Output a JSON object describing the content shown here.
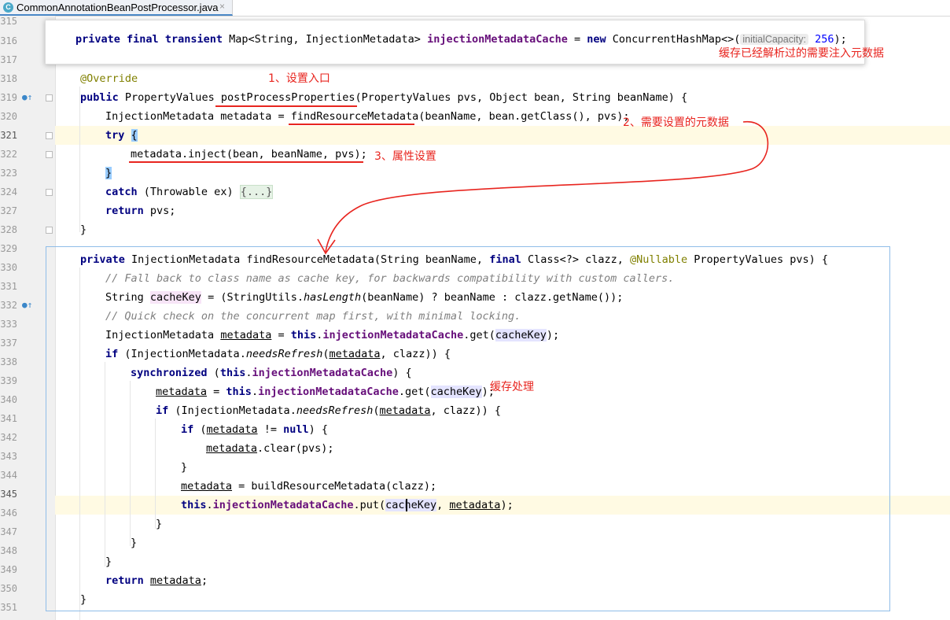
{
  "editor": {
    "tab": {
      "filename": "CommonAnnotationBeanPostProcessor.java",
      "close": "×",
      "icon_letter": "C"
    },
    "line_numbers": [
      "315",
      "316",
      "317",
      "318",
      "319",
      "320",
      "321",
      "322",
      "323",
      "324",
      "327",
      "328",
      "329",
      "330",
      "331",
      "332",
      "333",
      "337",
      "338",
      "339",
      "340",
      "341",
      "342",
      "343",
      "344",
      "345",
      "346",
      "347",
      "348",
      "349",
      "350",
      "351"
    ],
    "popup": {
      "t1": "private ",
      "t2": "final ",
      "t3": "transient ",
      "t4": "Map<String, InjectionMetadata> ",
      "field": "injectionMetadataCache",
      "t5": " = ",
      "t6": "new ",
      "t7": "ConcurrentHashMap<>(",
      "hint": "initialCapacity:",
      "num": "256",
      "t8": ");"
    },
    "code": {
      "l318": "@Override",
      "l319a": "public ",
      "l319b": "PropertyValues ",
      "l319c": "postProcessProperties",
      "l319d": "(PropertyValues pvs, Object bean, String beanName) {",
      "l320a": "InjectionMetadata metadata = ",
      "l320b": "findResourceMetadata",
      "l320c": "(beanName, bean.getClass(), pvs);",
      "l321a": "try ",
      "l321b": "{",
      "l322a": "metadata.inject(bean, beanName, pvs);",
      "l323": "}",
      "l324a": "catch ",
      "l324b": "(Throwable ex) ",
      "l324c": "{...}",
      "l327a": "return ",
      "l327b": "pvs;",
      "l328": "}",
      "l330a": "private ",
      "l330b": "InjectionMetadata findResourceMetadata(String beanName, ",
      "l330c": "final ",
      "l330d": "Class<?> clazz, ",
      "l330e": "@Nullable ",
      "l330f": "PropertyValues pvs) {",
      "l331": "// Fall back to class name as cache key, for backwards compatibility with custom callers.",
      "l332a": "String ",
      "l332b": "cacheKey",
      "l332c": " = (StringUtils.",
      "l332d": "hasLength",
      "l332e": "(beanName) ? beanName : clazz.getName());",
      "l333": "// Quick check on the concurrent map first, with minimal locking.",
      "l337a": "InjectionMetadata ",
      "l337b": "metadata",
      "l337c": " = ",
      "l337d": "this",
      "l337e": ".",
      "l337f": "injectionMetadataCache",
      "l337g": ".get(",
      "l337h": "cacheKey",
      "l337i": ");",
      "l338a": "if ",
      "l338b": "(InjectionMetadata.",
      "l338c": "needsRefresh",
      "l338d": "(",
      "l338e": "metadata",
      "l338f": ", clazz)) {",
      "l339a": "synchronized ",
      "l339b": "(",
      "l339c": "this",
      "l339d": ".",
      "l339e": "injectionMetadataCache",
      "l339f": ") {",
      "l340a": "metadata",
      "l340b": " = ",
      "l340c": "this",
      "l340d": ".",
      "l340e": "injectionMetadataCache",
      "l340f": ".get(",
      "l340g": "cacheKey",
      "l340h": ");",
      "l341a": "if ",
      "l341b": "(InjectionMetadata.",
      "l341c": "needsRefresh",
      "l341d": "(",
      "l341e": "metadata",
      "l341f": ", clazz)) {",
      "l342a": "if ",
      "l342b": "(",
      "l342c": "metadata",
      "l342d": " != ",
      "l342e": "null",
      "l342f": ") {",
      "l343a": "metadata",
      "l343b": ".clear(pvs);",
      "l344": "}",
      "l345a": "metadata",
      "l345b": " = buildResourceMetadata(clazz);",
      "l346a": "this",
      "l346b": ".",
      "l346c": "injectionMetadataCache",
      "l346d": ".put(",
      "l346e": "cacheKey",
      "l346f": ", ",
      "l346g": "metadata",
      "l346h": ");",
      "l347": "}",
      "l348": "}",
      "l349": "}",
      "l350a": "return ",
      "l350b": "metadata",
      "l350c": ";",
      "l351": "}"
    }
  },
  "annotations": {
    "a1": "缓存已经解析过的需要注入元数据",
    "a2": "1、设置入口",
    "a3": "2、需要设置的元数据",
    "a4": "3、属性设置",
    "a5": "缓存处理"
  },
  "colors": {
    "annotation_red": "#e8251f",
    "keyword": "#000080",
    "field": "#660e7a",
    "comment": "#808080",
    "panel_border": "#8fbde8"
  }
}
